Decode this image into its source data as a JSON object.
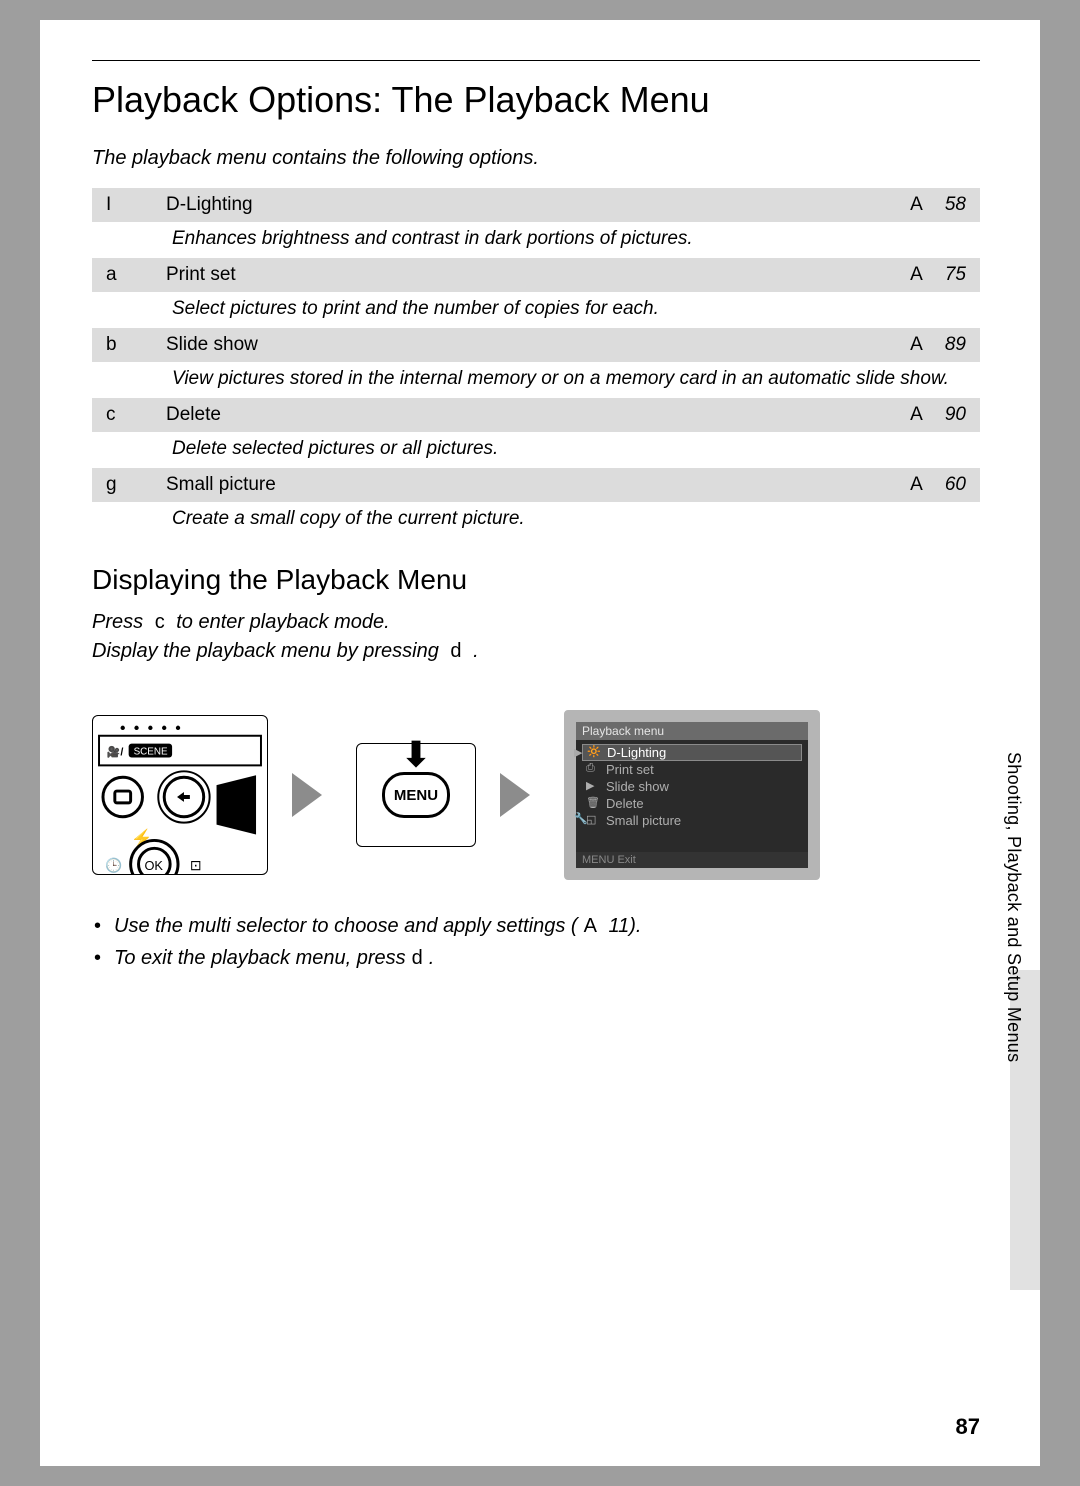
{
  "title": "Playback Options: The Playback Menu",
  "intro": "The playback menu contains the following options.",
  "options": [
    {
      "icon": "I",
      "name": "D-Lighting",
      "ref": "A",
      "page": "58",
      "desc": "Enhances brightness and contrast in dark portions of pictures."
    },
    {
      "icon": "a",
      "name": "Print set",
      "ref": "A",
      "page": "75",
      "desc": "Select pictures to print and the number of copies for each."
    },
    {
      "icon": "b",
      "name": "Slide show",
      "ref": "A",
      "page": "89",
      "desc": "View pictures stored in the internal memory or on a memory card in an automatic slide show."
    },
    {
      "icon": "c",
      "name": "Delete",
      "ref": "A",
      "page": "90",
      "desc": "Delete selected pictures or all pictures."
    },
    {
      "icon": "g",
      "name": "Small picture",
      "ref": "A",
      "page": "60",
      "desc": "Create a small copy of the current picture."
    }
  ],
  "subheading": "Displaying the Playback Menu",
  "instruction1_pre": "Press",
  "instruction1_sym": "c",
  "instruction1_post": " to enter playback mode.",
  "instruction2_pre": "Display the playback menu by pressing",
  "instruction2_sym": "d",
  "instruction2_post": ".",
  "menu_button": "MENU",
  "lcd": {
    "title": "Playback menu",
    "items": [
      "D-Lighting",
      "Print set",
      "Slide show",
      "Delete",
      "Small picture"
    ],
    "footer": "MENU Exit"
  },
  "bullets": {
    "b1_pre": "Use the multi selector to choose and apply settings (",
    "b1_sym": "A",
    "b1_page": "11",
    "b1_post": ").",
    "b2_pre": "To exit the playback menu, press",
    "b2_sym": "d",
    "b2_post": "."
  },
  "side_label": "Shooting, Playback and Setup Menus",
  "page_number": "87"
}
